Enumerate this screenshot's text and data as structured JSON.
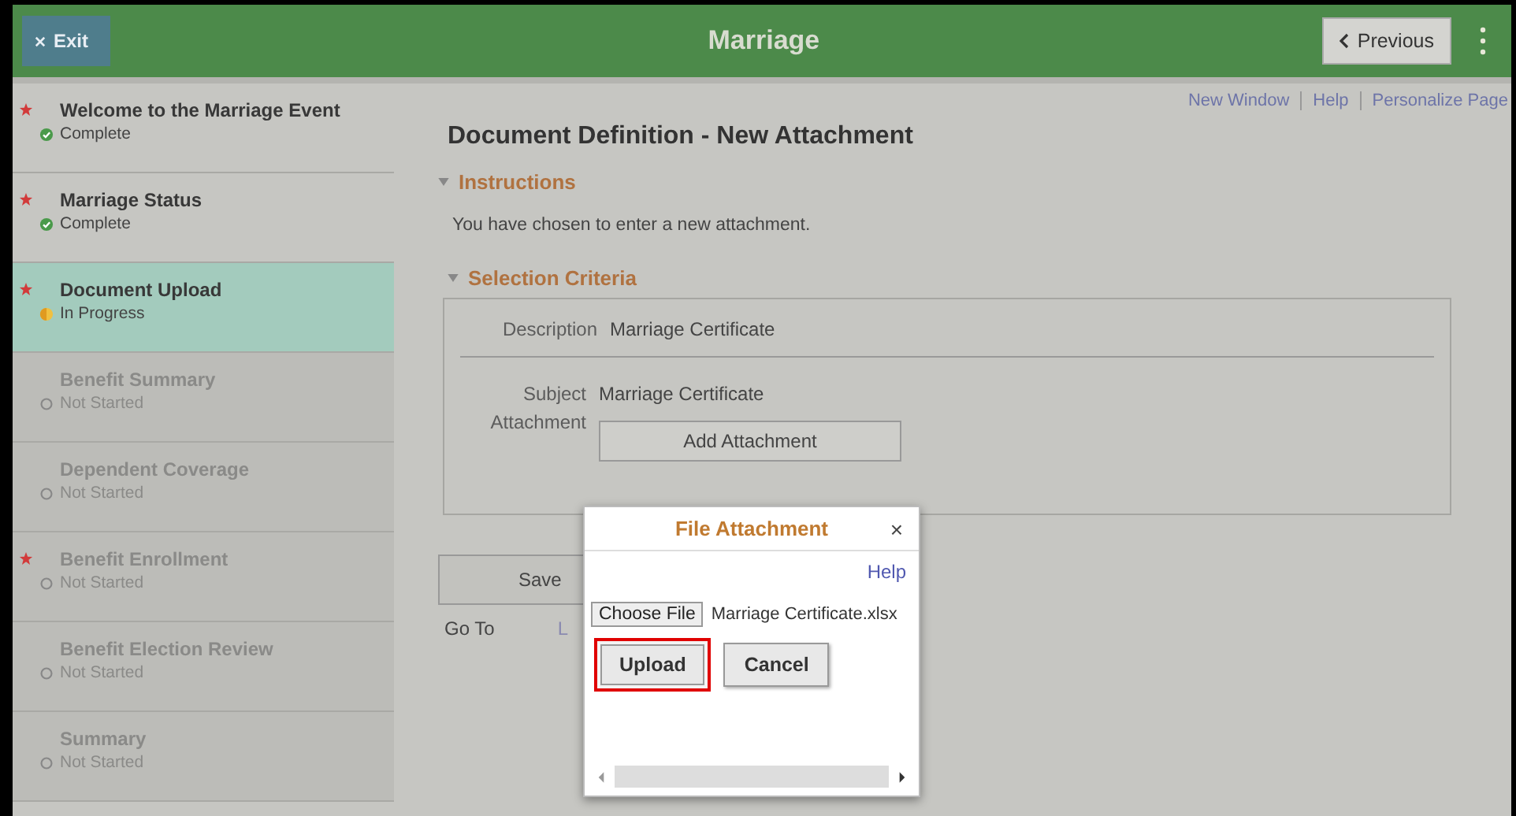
{
  "header": {
    "exit_label": "Exit",
    "title": "Marriage",
    "previous_label": "Previous"
  },
  "steps": [
    {
      "title": "Welcome to the Marriage Event",
      "status": "Complete",
      "kind": "complete",
      "required": true,
      "selected": false,
      "disabled": false
    },
    {
      "title": "Marriage Status",
      "status": "Complete",
      "kind": "complete",
      "required": true,
      "selected": false,
      "disabled": false
    },
    {
      "title": "Document Upload",
      "status": "In Progress",
      "kind": "in_progress",
      "required": true,
      "selected": true,
      "disabled": false
    },
    {
      "title": "Benefit Summary",
      "status": "Not Started",
      "kind": "not_started",
      "required": false,
      "selected": false,
      "disabled": true
    },
    {
      "title": "Dependent Coverage",
      "status": "Not Started",
      "kind": "not_started",
      "required": false,
      "selected": false,
      "disabled": true
    },
    {
      "title": "Benefit Enrollment",
      "status": "Not Started",
      "kind": "not_started",
      "required": true,
      "selected": false,
      "disabled": true
    },
    {
      "title": "Benefit Election Review",
      "status": "Not Started",
      "kind": "not_started",
      "required": false,
      "selected": false,
      "disabled": true
    },
    {
      "title": "Summary",
      "status": "Not Started",
      "kind": "not_started",
      "required": false,
      "selected": false,
      "disabled": true
    }
  ],
  "top_links": [
    "New Window",
    "Help",
    "Personalize Page"
  ],
  "page_title": "Document Definition - New Attachment",
  "instructions": {
    "heading": "Instructions",
    "text": "You have chosen to enter a new attachment."
  },
  "selection_criteria": {
    "heading": "Selection Criteria",
    "description_label": "Description",
    "description_value": "Marriage Certificate",
    "subject_label": "Subject",
    "subject_value": "Marriage Certificate",
    "attachment_label": "Attachment",
    "add_button": "Add Attachment"
  },
  "save_button": "Save",
  "go_to_label": "Go To",
  "go_to_link": "L",
  "dialog": {
    "title": "File Attachment",
    "close": "×",
    "help_link": "Help",
    "choose_file": "Choose File",
    "file_name": "Marriage Certificate.xlsx",
    "buttons": [
      {
        "label": "Upload",
        "highlighted": true
      },
      {
        "label": "Cancel",
        "highlighted": false
      }
    ]
  }
}
